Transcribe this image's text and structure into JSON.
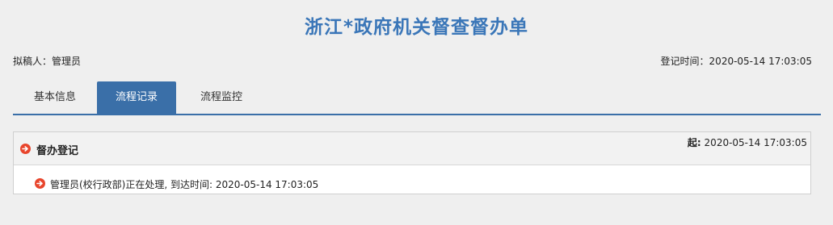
{
  "header": {
    "title": "浙江*政府机关督查督办单"
  },
  "meta": {
    "drafter": "拟稿人：管理员",
    "register_time": "登记时间：2020-05-14 17:03:05"
  },
  "tabs": [
    {
      "label": "基本信息",
      "active": false
    },
    {
      "label": "流程记录",
      "active": true
    },
    {
      "label": "流程监控",
      "active": false
    }
  ],
  "panel": {
    "title": "督办登记",
    "start_label": "起:",
    "start_time": "2020-05-14 17:03:05",
    "row_text": "管理员(校行政部)正在处理, 到达时间: 2020-05-14 17:03:05"
  },
  "colors": {
    "accent": "#3a6fa8",
    "title": "#3a76b8",
    "icon": "#e8452c"
  },
  "icons": [
    "arrow-right-circle-icon"
  ]
}
